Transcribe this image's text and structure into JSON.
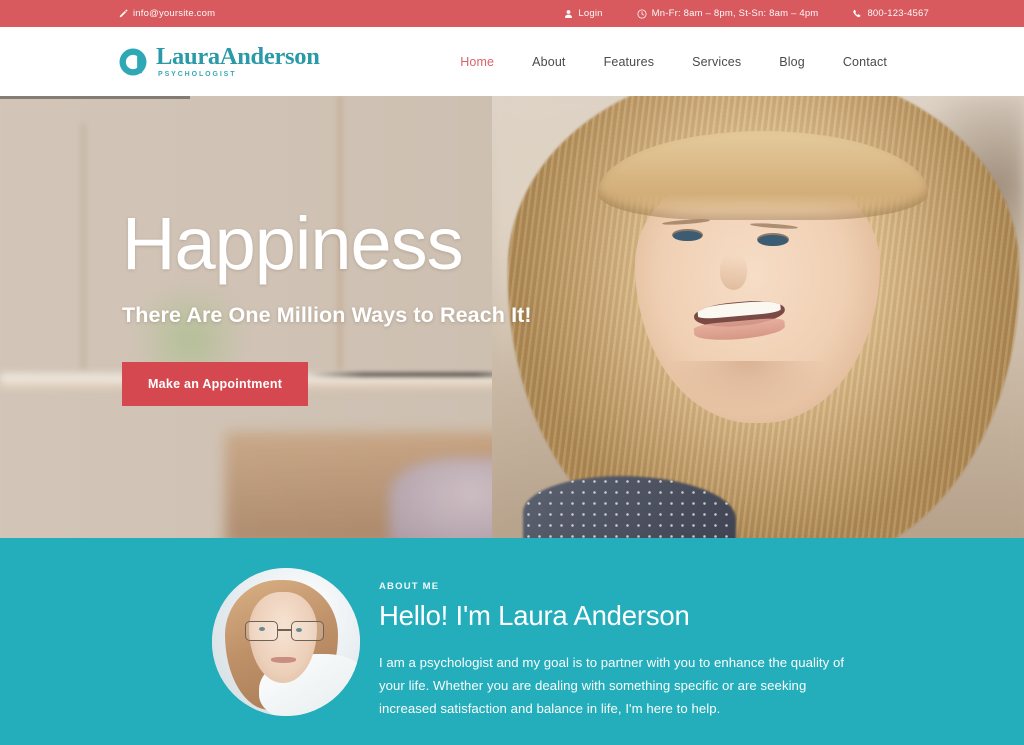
{
  "topbar": {
    "email": "info@yoursite.com",
    "email_icon": "pencil-icon",
    "login_label": "Login",
    "login_icon": "user-icon",
    "hours": "Mn-Fr: 8am – 8pm, St-Sn: 8am – 4pm",
    "hours_icon": "clock-icon",
    "phone": "800-123-4567",
    "phone_icon": "phone-icon",
    "background_color": "#d8595e"
  },
  "header": {
    "logo": {
      "mark_icon": "logo-circle-monogram-icon",
      "name": "LauraAnderson",
      "tagline": "PSYCHOLOGIST",
      "color": "#2a9aa8"
    },
    "nav": [
      {
        "label": "Home",
        "active": true
      },
      {
        "label": "About",
        "active": false
      },
      {
        "label": "Features",
        "active": false
      },
      {
        "label": "Services",
        "active": false
      },
      {
        "label": "Blog",
        "active": false
      },
      {
        "label": "Contact",
        "active": false
      }
    ],
    "active_color": "#d9636b"
  },
  "hero": {
    "title": "Happiness",
    "subtitle": "There Are One Million Ways to Reach It!",
    "button_label": "Make an Appointment",
    "button_color": "#d6484f",
    "image_alt": "smiling-blonde-woman-portrait"
  },
  "about": {
    "eyebrow": "ABOUT ME",
    "title": "Hello! I'm Laura Anderson",
    "body": "I am a psychologist and my goal is to partner with you to enhance the quality of your life. Whether you are dealing with something specific or are seeking increased satisfaction and balance in life, I'm here to help.",
    "avatar_alt": "laura-anderson-portrait",
    "background_color": "#24aebb"
  }
}
